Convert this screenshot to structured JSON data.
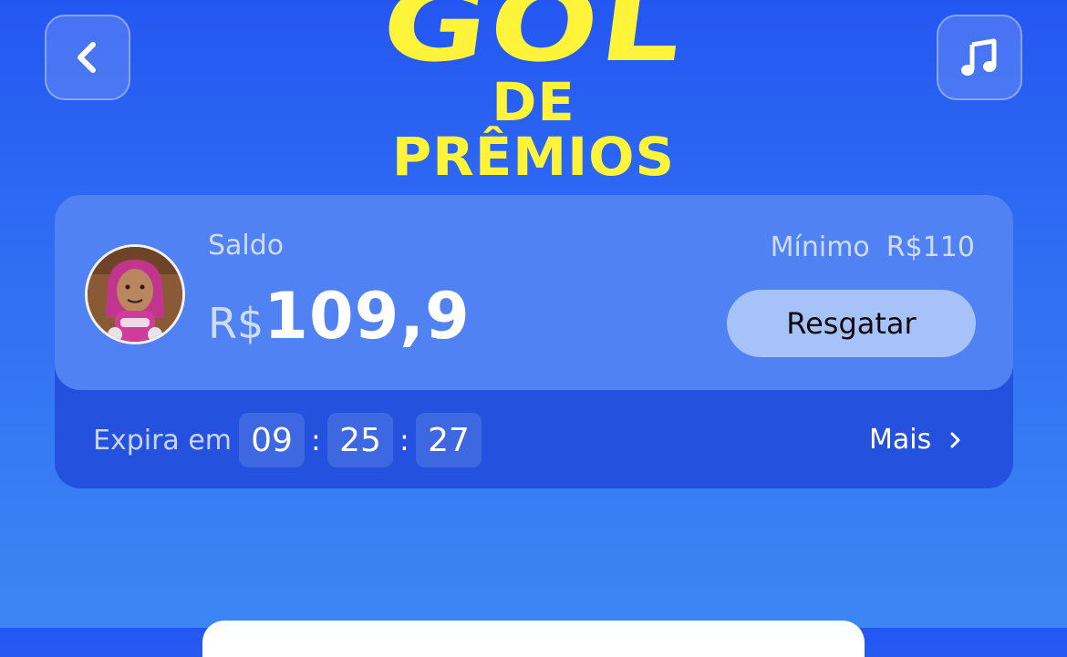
{
  "header": {
    "back_icon": "chevron-left-icon",
    "music_icon": "music-note-icon",
    "logo_line1": "GOL",
    "logo_line2": "DE PRÊMIOS"
  },
  "balance_card": {
    "saldo_label": "Saldo",
    "currency": "R$",
    "amount": "109,9",
    "minimo_label": "Mínimo",
    "minimo_value": "R$110",
    "resgatar_label": "Resgatar",
    "expira_label": "Expira em",
    "timer": {
      "hours": "09",
      "minutes": "25",
      "seconds": "27",
      "separator": ":"
    },
    "mais_label": "Mais",
    "mais_icon": "chevron-right-icon"
  },
  "colors": {
    "background": "#2f6df3",
    "logo_yellow": "#fff43a",
    "card_top": "#5082f4",
    "card_bottom": "#2452de",
    "button": "#a6c2f8"
  }
}
